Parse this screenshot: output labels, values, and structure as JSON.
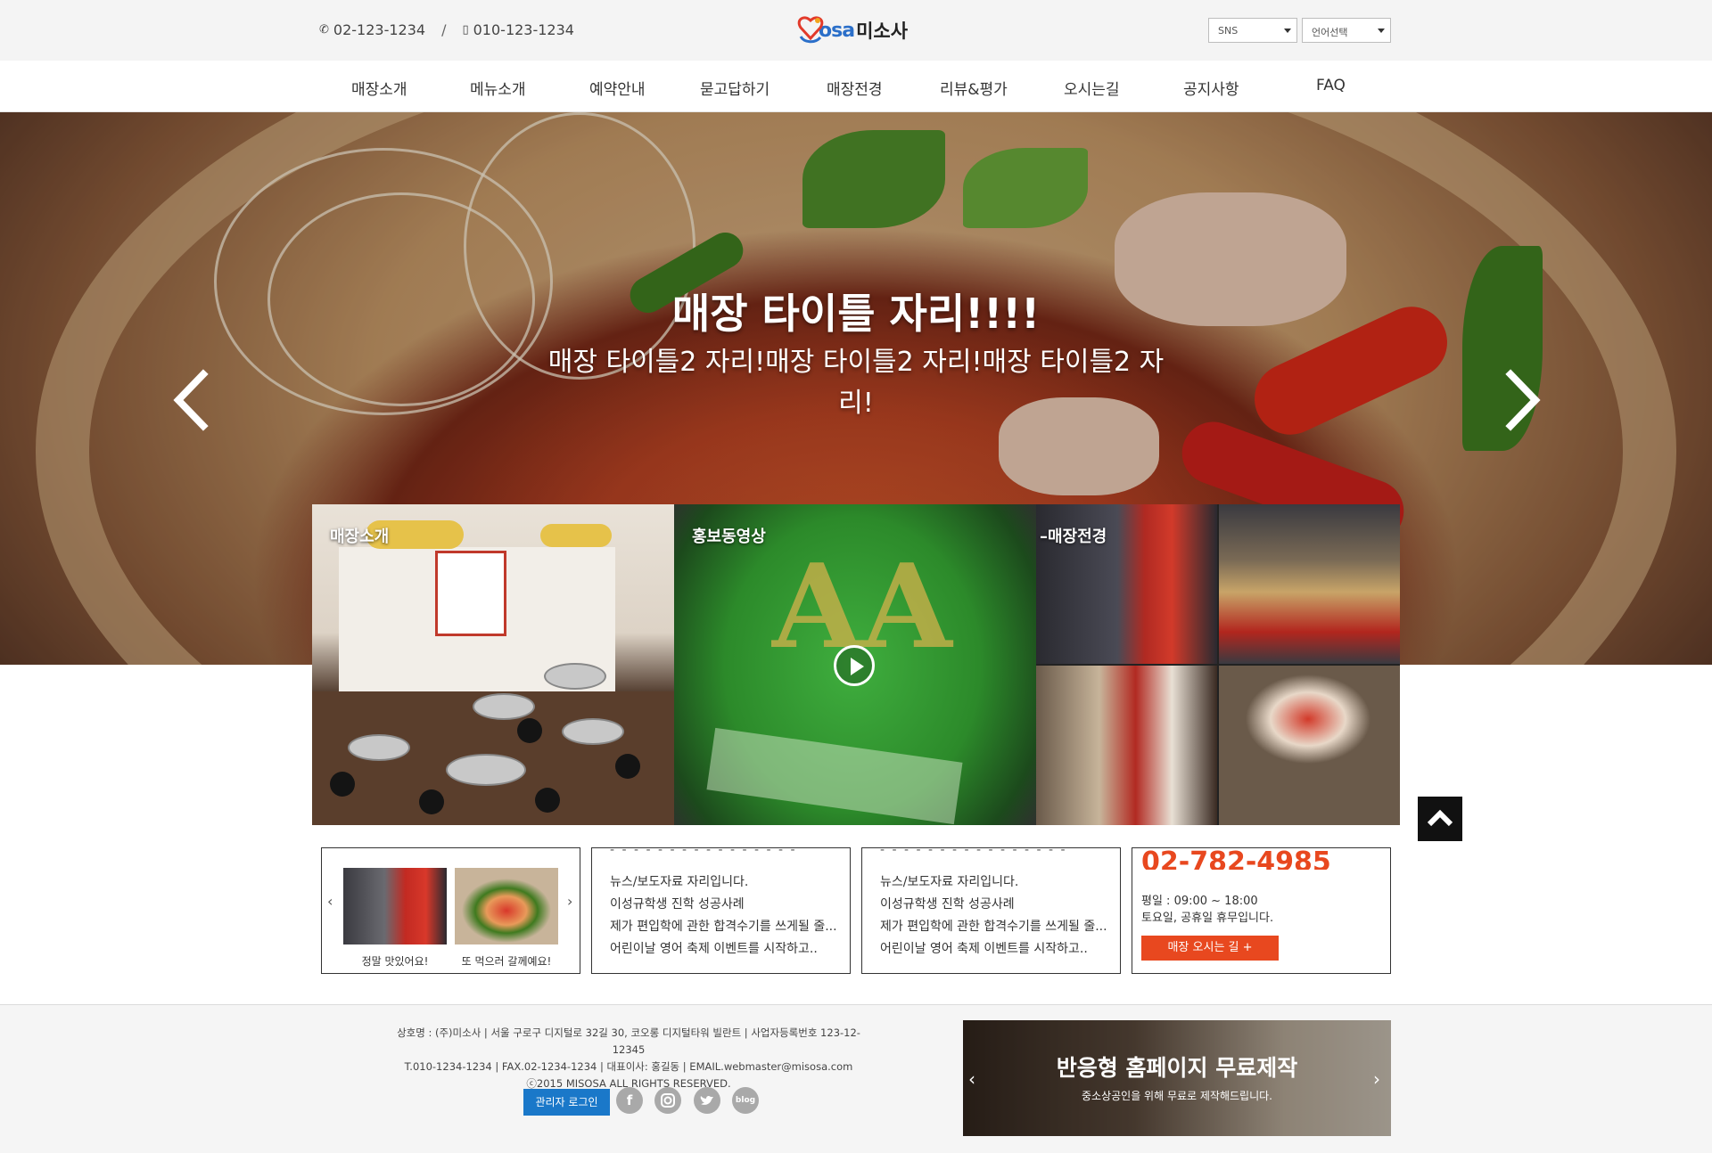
{
  "header": {
    "phone1": "02-123-1234",
    "separator": "/",
    "phone2": "010-123-1234",
    "logo_en": "osa",
    "logo_kr": "미소사",
    "sns_select": "SNS",
    "lang_select": "언어선택"
  },
  "nav": {
    "items": [
      "매장소개",
      "메뉴소개",
      "예약안내",
      "묻고답하기",
      "매장전경",
      "리뷰&평가",
      "오시는길",
      "공지사항",
      "FAQ"
    ]
  },
  "hero": {
    "title": "매장 타이틀 자리!!!!",
    "subtitle": "매장 타이틀2 자리!매장 타이틀2 자리!매장 타이틀2 자리!"
  },
  "tiles": {
    "t1": "매장소개",
    "t2": "홍보동영상",
    "t3": "매장전경"
  },
  "review": {
    "caption1": "정말 맛있어요!",
    "caption2": "또 먹으러 갈께예요!"
  },
  "news": {
    "items": [
      "뉴스/보도자료 자리입니다.",
      "이성규학생 진학 성공사례",
      "제가 편입학에 관한 합격수기를 쓰게될 줄...",
      "어린이날 영어 축제 이벤트를 시작하고.."
    ]
  },
  "notice": {
    "items": [
      "뉴스/보도자료 자리입니다.",
      "이성규학생 진학 성공사례",
      "제가 편입학에 관한 합격수기를 쓰게될 줄...",
      "어린이날 영어 축제 이벤트를 시작하고.."
    ]
  },
  "contact": {
    "phone": "02-782-4985",
    "hours1": "평일 : 09:00 ~ 18:00",
    "hours2": "토요일, 공휴일 휴무입니다.",
    "directions": "매장 오시는 길 +"
  },
  "footer": {
    "line1": "상호명 : (주)미소사 | 서울 구로구 디지털로 32길 30, 코오롱 디지털타워 빌란트 | 사업자등록번호 123-12-12345",
    "line2": "T.010-1234-1234 | FAX.02-1234-1234 | 대표이사: 홍길동 | EMAIL.webmaster@misosa.com",
    "line3": "ⓒ2015 MISOSA ALL RIGHTS RESERVED.",
    "admin_login": "관리자 로그인",
    "social": {
      "facebook": "f",
      "blog": "blog"
    },
    "banner_title": "반응형 홈페이지 무료제작",
    "banner_sub": "중소상공인을 위해 무료로 제작해드립니다."
  },
  "colors": {
    "accent": "#e8481f",
    "admin_blue": "#1a78c9",
    "logo_blue": "#2b6fc9"
  }
}
